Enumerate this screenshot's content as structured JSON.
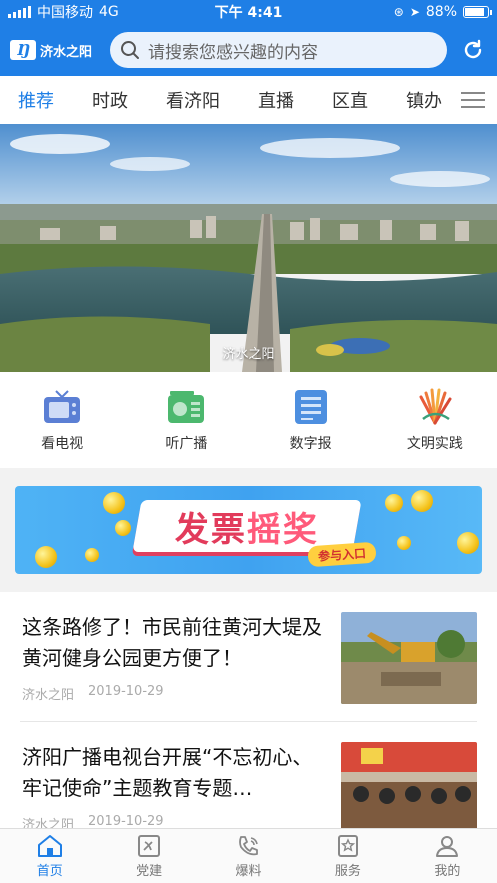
{
  "status_bar": {
    "carrier": "中国移动",
    "network": "4G",
    "time": "下午 4:41",
    "battery": "88%",
    "battery_level": 0.88
  },
  "header": {
    "logo_text": "济水之阳",
    "search_placeholder": "请搜索您感兴趣的内容"
  },
  "tabs": [
    {
      "label": "推荐",
      "active": true
    },
    {
      "label": "时政"
    },
    {
      "label": "看济阳"
    },
    {
      "label": "直播"
    },
    {
      "label": "区直"
    },
    {
      "label": "镇办"
    }
  ],
  "banner": {
    "caption": "济水之阳"
  },
  "quick_links": [
    {
      "label": "看电视",
      "icon": "tv-icon"
    },
    {
      "label": "听广播",
      "icon": "radio-icon"
    },
    {
      "label": "数字报",
      "icon": "newspaper-icon"
    },
    {
      "label": "文明实践",
      "icon": "civilization-icon"
    }
  ],
  "ad": {
    "title_a": "发票",
    "title_b": "摇奖",
    "cta": "参与入口"
  },
  "news": [
    {
      "title": "这条路修了！市民前往黄河大堤及黄河健身公园更方便了！",
      "source": "济水之阳",
      "date": "2019-10-29"
    },
    {
      "title": "济阳广播电视台开展“不忘初心、牢记使命”主题教育专题…",
      "source": "济水之阳",
      "date": "2019-10-29"
    }
  ],
  "bottom_nav": [
    {
      "label": "首页",
      "icon": "home-icon",
      "active": true
    },
    {
      "label": "党建",
      "icon": "party-icon"
    },
    {
      "label": "爆料",
      "icon": "phone-icon"
    },
    {
      "label": "服务",
      "icon": "service-icon"
    },
    {
      "label": "我的",
      "icon": "user-icon"
    }
  ],
  "colors": {
    "brand": "#1f7fe6",
    "active_tab": "#1f7fe6"
  }
}
